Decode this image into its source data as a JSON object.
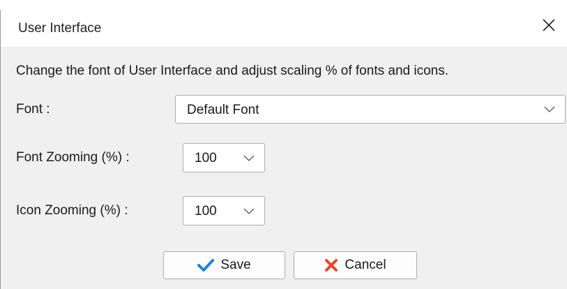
{
  "window": {
    "title": "User Interface"
  },
  "description": "Change the font of User Interface and adjust scaling % of fonts and icons.",
  "font": {
    "label": "Font :",
    "value": "Default Font"
  },
  "font_zoom": {
    "label": "Font Zooming (%) :",
    "value": "100"
  },
  "icon_zoom": {
    "label": "Icon Zooming (%) :",
    "value": "100"
  },
  "buttons": {
    "save_label": "Save",
    "cancel_label": "Cancel"
  },
  "colors": {
    "save_icon": "#1f7fe0",
    "cancel_icon": "#e8452c"
  },
  "icons": {
    "close": "close-icon",
    "dropdown": "chevron-down-icon",
    "save": "checkmark-icon",
    "cancel": "x-icon"
  }
}
